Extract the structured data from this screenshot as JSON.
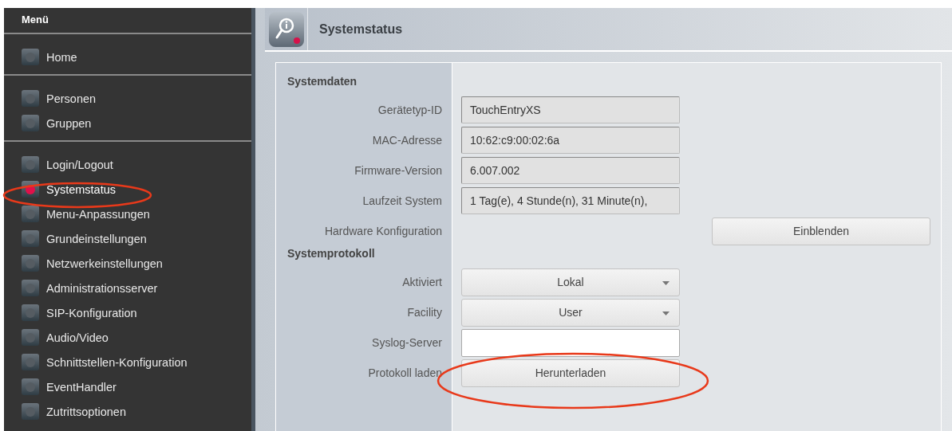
{
  "sidebar": {
    "title": "Menü",
    "groups": [
      {
        "items": [
          {
            "label": "Home",
            "selected": false
          }
        ]
      },
      {
        "items": [
          {
            "label": "Personen",
            "selected": false
          },
          {
            "label": "Gruppen",
            "selected": false
          }
        ]
      },
      {
        "items": [
          {
            "label": "Login/Logout",
            "selected": false
          },
          {
            "label": "Systemstatus",
            "selected": true
          },
          {
            "label": "Menu-Anpassungen",
            "selected": false
          },
          {
            "label": "Grundeinstellungen",
            "selected": false
          },
          {
            "label": "Netzwerkeinstellungen",
            "selected": false
          },
          {
            "label": "Administrationsserver",
            "selected": false
          },
          {
            "label": "SIP-Konfiguration",
            "selected": false
          },
          {
            "label": "Audio/Video",
            "selected": false
          },
          {
            "label": "Schnittstellen-Konfiguration",
            "selected": false
          },
          {
            "label": "EventHandler",
            "selected": false
          },
          {
            "label": "Zutrittsoptionen",
            "selected": false
          }
        ]
      }
    ]
  },
  "page": {
    "title": "Systemstatus"
  },
  "sections": [
    {
      "title": "Systemdaten",
      "rows": [
        {
          "kind": "readonly",
          "label": "Gerätetyp-ID",
          "value": "TouchEntryXS"
        },
        {
          "kind": "readonly",
          "label": "MAC-Adresse",
          "value": "10:62:c9:00:02:6a"
        },
        {
          "kind": "readonly",
          "label": "Firmware-Version",
          "value": "6.007.002"
        },
        {
          "kind": "readonly",
          "label": "Laufzeit System",
          "value": "1 Tag(e), 4 Stunde(n), 31 Minute(n),"
        },
        {
          "kind": "side-button",
          "label": "Hardware Konfiguration",
          "value": "Einblenden"
        }
      ]
    },
    {
      "title": "Systemprotokoll",
      "rows": [
        {
          "kind": "select",
          "label": "Aktiviert",
          "value": "Lokal"
        },
        {
          "kind": "select",
          "label": "Facility",
          "value": "User"
        },
        {
          "kind": "input",
          "label": "Syslog-Server"
        },
        {
          "kind": "button",
          "label": "Protokoll laden",
          "value": "Herunterladen"
        }
      ]
    }
  ]
}
